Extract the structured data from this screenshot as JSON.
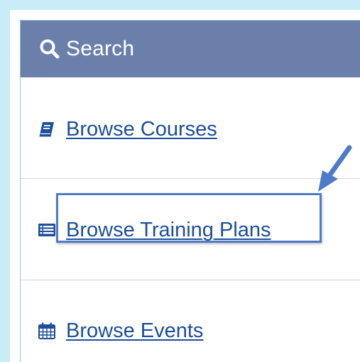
{
  "header": {
    "title": "Search",
    "icon": "search-icon",
    "color": "#6b7fab"
  },
  "menu": {
    "items": [
      {
        "label": "Browse Courses",
        "icon": "book-icon"
      },
      {
        "label": "Browse Training Plans",
        "icon": "list-icon"
      },
      {
        "label": "Browse Events",
        "icon": "calendar-icon"
      }
    ]
  },
  "colors": {
    "link": "#1b4e9b",
    "highlight": "#4d7bc9",
    "border": "#c9ecf9"
  }
}
